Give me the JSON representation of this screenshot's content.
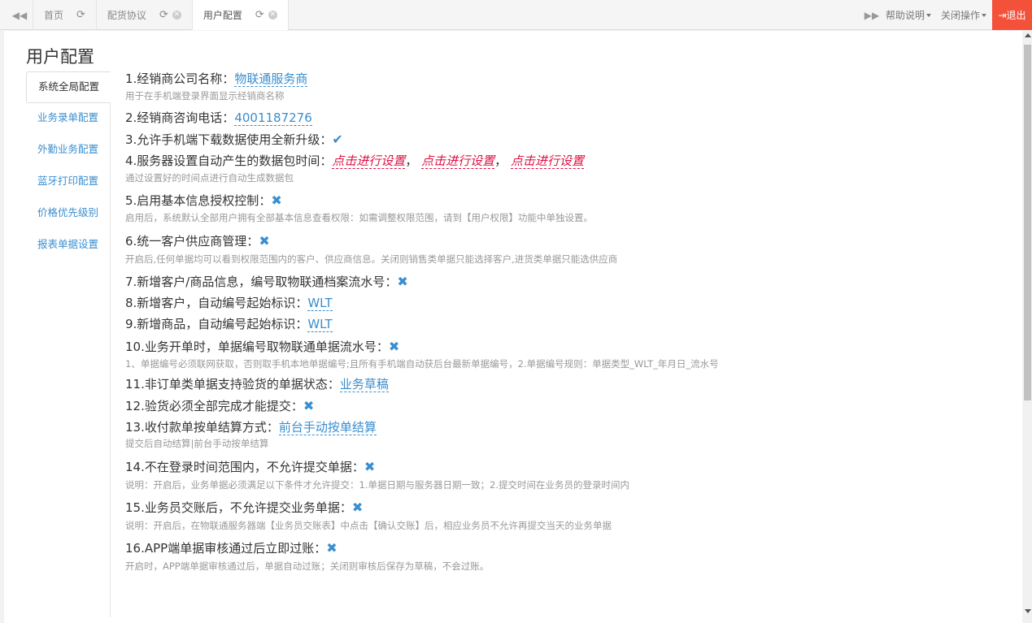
{
  "colors": {
    "accent": "#3a8ecf",
    "danger": "#dd1144",
    "logout_bg": "#f4513b"
  },
  "tabs": [
    {
      "label": "首页",
      "active": false
    },
    {
      "label": "配货协议",
      "active": false
    },
    {
      "label": "用户配置",
      "active": true
    }
  ],
  "topbar": {
    "help": "帮助说明",
    "close_ops": "关闭操作",
    "logout": "退出"
  },
  "page_title": "用户配置",
  "sidebar": {
    "items": [
      {
        "label": "系统全局配置",
        "active": true
      },
      {
        "label": "业务录单配置"
      },
      {
        "label": "外勤业务配置"
      },
      {
        "label": "蓝牙打印配置"
      },
      {
        "label": "价格优先级别"
      },
      {
        "label": "报表单据设置"
      }
    ]
  },
  "settings": {
    "s1": {
      "label": "1.经销商公司名称：",
      "value": "物联通服务商",
      "desc": "用于在手机端登录界面显示经销商名称"
    },
    "s2": {
      "label": "2.经销商咨询电话：",
      "value": "4001187276"
    },
    "s3": {
      "label": "3.允许手机端下载数据使用全新升级：",
      "state": "on"
    },
    "s4": {
      "label": "4.服务器设置自动产生的数据包时间：",
      "link1": "点击进行设置",
      "link2": "点击进行设置",
      "link3": "点击进行设置",
      "sep": "，",
      "desc": "通过设置好的时间点进行自动生成数据包"
    },
    "s5": {
      "label": "5.启用基本信息授权控制：",
      "state": "off",
      "desc": "启用后，系统默认全部用户拥有全部基本信息查看权限：如需调整权限范围，请到【用户权限】功能中单独设置。"
    },
    "s6": {
      "label": "6.统一客户供应商管理：",
      "state": "off",
      "desc": "开启后,任何单据均可以看到权限范围内的客户、供应商信息。关闭则销售类单据只能选择客户,进货类单据只能选供应商"
    },
    "s7": {
      "label": "7.新增客户/商品信息，编号取物联通档案流水号：",
      "state": "off"
    },
    "s8": {
      "label": "8.新增客户，自动编号起始标识：",
      "value": "WLT"
    },
    "s9": {
      "label": "9.新增商品，自动编号起始标识：",
      "value": "WLT"
    },
    "s10": {
      "label": "10.业务开单时，单据编号取物联通单据流水号：",
      "state": "off",
      "desc": "1、单据编号必须联网获取，否则取手机本地单据编号;且所有手机端自动获后台最新单据编号，2.单据编号规则：单据类型_WLT_年月日_流水号"
    },
    "s11": {
      "label": "11.非订单类单据支持验货的单据状态：",
      "value": "业务草稿"
    },
    "s12": {
      "label": "12.验货必须全部完成才能提交：",
      "state": "off"
    },
    "s13": {
      "label": "13.收付款单按单结算方式：",
      "value": "前台手动按单结算",
      "desc": "提交后自动结算|前台手动按单结算"
    },
    "s14": {
      "label": "14.不在登录时间范围内，不允许提交单据：",
      "state": "off",
      "desc": "说明：开启后，业务单据必须满足以下条件才允许提交：1.单据日期与服务器日期一致；2.提交时间在业务员的登录时间内"
    },
    "s15": {
      "label": "15.业务员交账后，不允许提交业务单据：",
      "state": "off",
      "desc": "说明：开启后，在物联通服务器端【业务员交账表】中点击【确认交账】后，相应业务员不允许再提交当天的业务单据"
    },
    "s16": {
      "label": "16.APP端单据审核通过后立即过账：",
      "state": "off",
      "desc": "开启时，APP端单据审核通过后，单据自动过账；关闭则审核后保存为草稿，不会过账。"
    }
  }
}
